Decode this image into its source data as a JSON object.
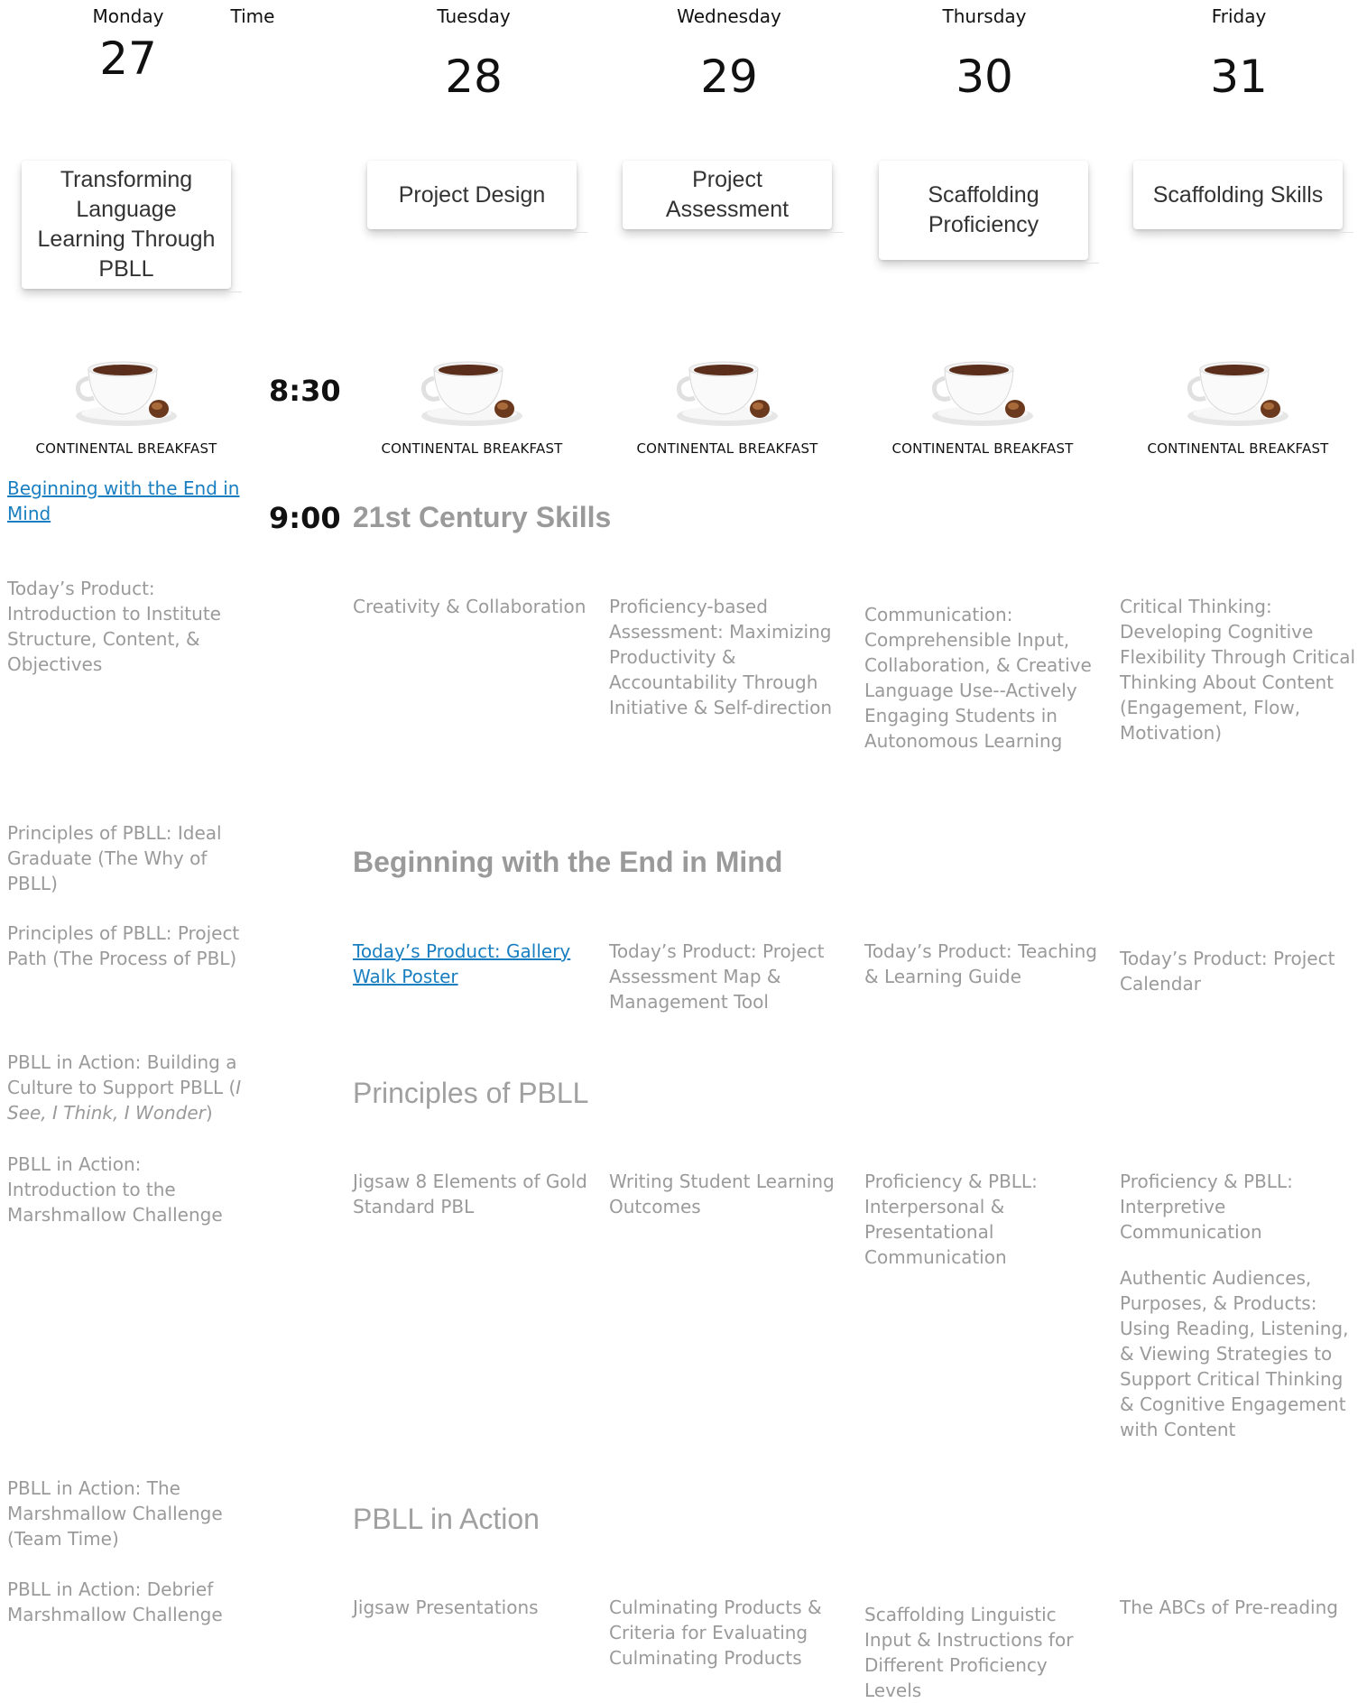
{
  "header": {
    "days": [
      {
        "name": "Monday",
        "num": "27"
      },
      {
        "name": "Tuesday",
        "num": "28"
      },
      {
        "name": "Wednesday",
        "num": "29"
      },
      {
        "name": "Thursday",
        "num": "30"
      },
      {
        "name": "Friday",
        "num": "31"
      }
    ],
    "time_label": "Time"
  },
  "themes": {
    "monday": "Transforming Language Learning Through PBLL",
    "tuesday": "Project Design",
    "wednesday": "Project Assessment",
    "thursday": "Scaffolding Proficiency",
    "friday": "Scaffolding Skills"
  },
  "breakfast": {
    "label": "CONTINENTAL BREAKFAST",
    "time": "8:30"
  },
  "slot_900": {
    "time": "9:00",
    "heading": "21st Century Skills"
  },
  "monday": {
    "link": "Beginning with the End in Mind",
    "product": "Today’s Product: Introduction to Institute Structure, Content, & Objectives",
    "principles1": "Principles of PBLL:  Ideal Graduate (The Why of PBLL)",
    "principles2": "Principles of PBLL:  Project Path (The Process of PBL)",
    "action1_pre": "PBLL in Action:  Building a Culture to Support PBLL  (",
    "action1_em": "I See, I Think, I Wonder",
    "action1_post": ")",
    "action2": "PBLL in Action: Introduction to the Marshmallow Challenge",
    "action3": "PBLL in Action:  The Marshmallow Challenge (Team Time)",
    "action4": "PBLL in Action:  Debrief Marshmallow Challenge"
  },
  "skills": {
    "tuesday": "Creativity & Collaboration",
    "wednesday": "Proficiency-based Assessment: Maximizing Productivity & Accountability Through Initiative & Self-direction",
    "thursday": "Communication: Comprehensible Input, Collaboration, & Creative Language Use--Actively Engaging Students in Autonomous Learning",
    "friday": "Critical Thinking: Developing Cognitive Flexibility Through Critical Thinking About Content (Engagement, Flow, Motivation)"
  },
  "end_in_mind": {
    "heading": "Beginning with the End in Mind",
    "tuesday": "Today’s Product: Gallery Walk Poster",
    "wednesday": "Today’s Product: Project Assessment Map & Management Tool",
    "thursday": "Today’s Product: Teaching & Learning Guide",
    "friday": "Today’s Product: Project Calendar"
  },
  "principles": {
    "heading": "Principles of PBLL",
    "tuesday": "Jigsaw 8 Elements of Gold Standard PBL",
    "wednesday": "Writing Student Learning Outcomes",
    "thursday": "Proficiency & PBLL: Interpersonal & Presentational Communication",
    "friday": "Proficiency & PBLL: Interpretive Communication",
    "friday2": "Authentic Audiences, Purposes, & Products: Using Reading, Listening, & Viewing Strategies to Support Critical Thinking & Cognitive Engagement with Content"
  },
  "in_action": {
    "heading": "PBLL in Action",
    "tuesday": "Jigsaw Presentations",
    "wednesday": "Culminating Products & Criteria for Evaluating Culminating Products",
    "thursday": "Scaffolding Linguistic Input & Instructions for Different Proficiency Levels",
    "friday": "The ABCs of Pre-reading"
  }
}
